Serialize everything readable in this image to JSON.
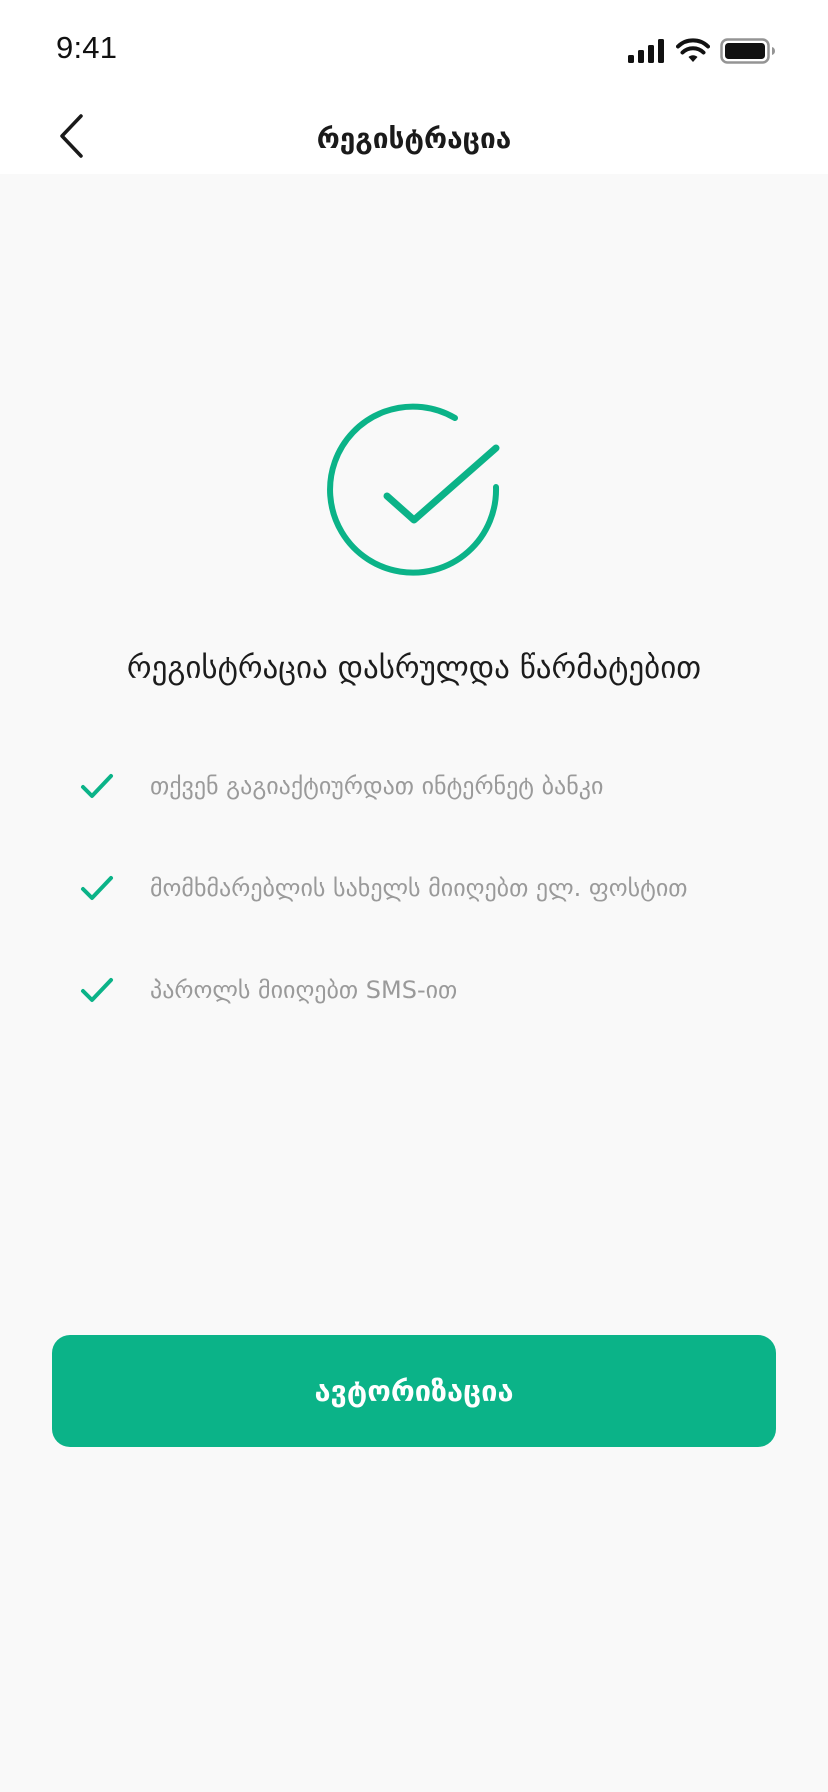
{
  "status_bar": {
    "time": "9:41",
    "icons": [
      "signal-icon",
      "wifi-icon",
      "battery-icon"
    ]
  },
  "nav": {
    "back_icon": "chevron-left-icon",
    "title": "რეგისტრაცია"
  },
  "success": {
    "icon": "check-circle-icon",
    "title": "რეგისტრაცია დასრულდა წარმატებით"
  },
  "info_items": [
    {
      "icon": "check-icon",
      "text": "თქვენ გაგიაქტიურდათ ინტერნეტ ბანკი"
    },
    {
      "icon": "check-icon",
      "text": "მომხმარებლის სახელს მიიღებთ ელ. ფოსტით"
    },
    {
      "icon": "check-icon",
      "text": "პაროლს მიიღებთ SMS-ით"
    }
  ],
  "action": {
    "label": "ავტორიზაცია"
  },
  "colors": {
    "accent": "#0bb388",
    "background": "#f9f9f9",
    "secondary_text": "#9a9a9a",
    "primary_text": "#1c1c1c"
  }
}
